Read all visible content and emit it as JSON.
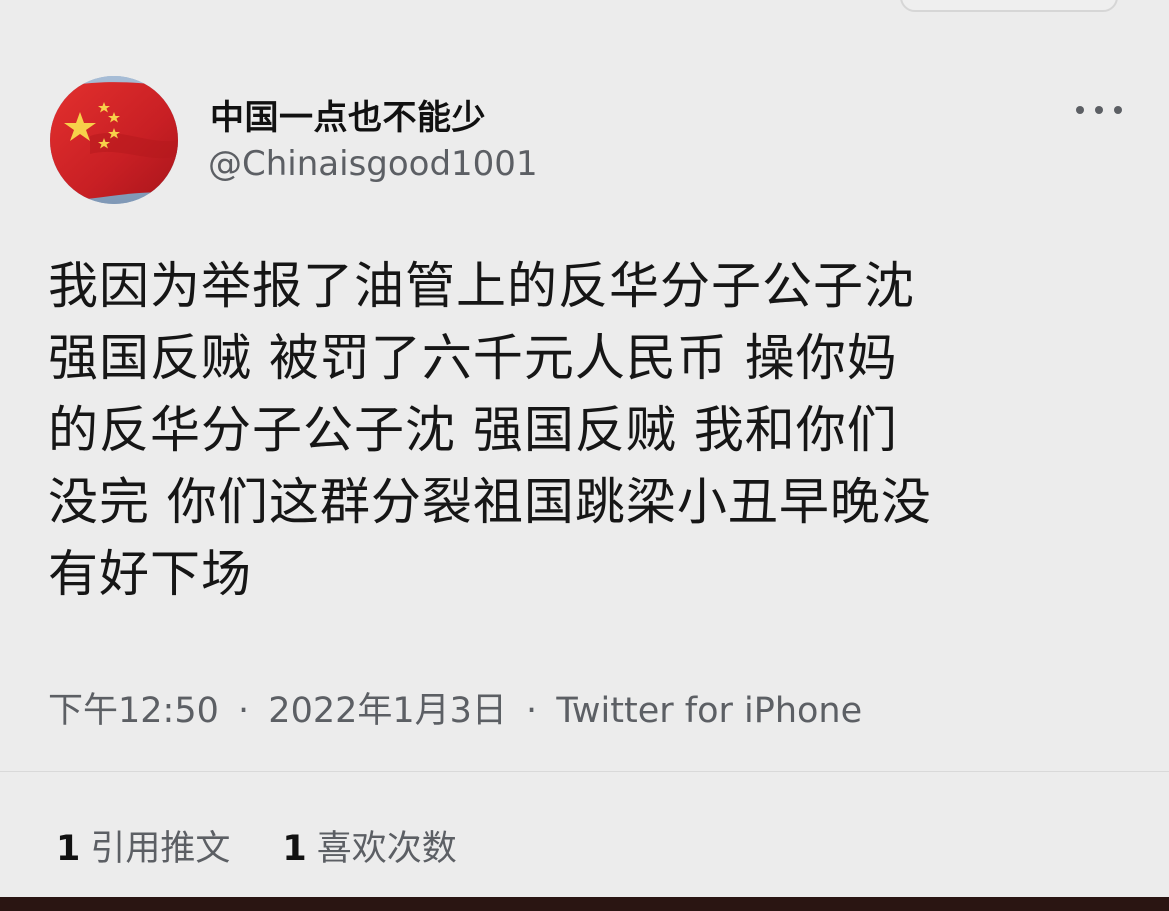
{
  "author": {
    "display_name": "中国一点也不能少",
    "handle": "@Chinaisgood1001",
    "avatar_icon": "china-flag-avatar"
  },
  "tweet": {
    "lines": [
      "我因为举报了油管上的反华分子公子沈",
      "强国反贼 被罚了六千元人民币 操你妈",
      "的反华分子公子沈 强国反贼 我和你们",
      "没完 你们这群分裂祖国跳梁小丑早晚没",
      "有好下场"
    ]
  },
  "meta": {
    "time": "下午12:50",
    "date": "2022年1月3日",
    "source": "Twitter for iPhone",
    "separator": "·"
  },
  "stats": {
    "quote_count": "1",
    "quote_label": "引用推文",
    "like_count": "1",
    "like_label": "喜欢次数"
  },
  "colors": {
    "background": "#ececec",
    "text_primary": "#111111",
    "text_secondary": "#5c5f64",
    "flag_red": "#d8262b",
    "flag_star": "#f7d14a"
  }
}
